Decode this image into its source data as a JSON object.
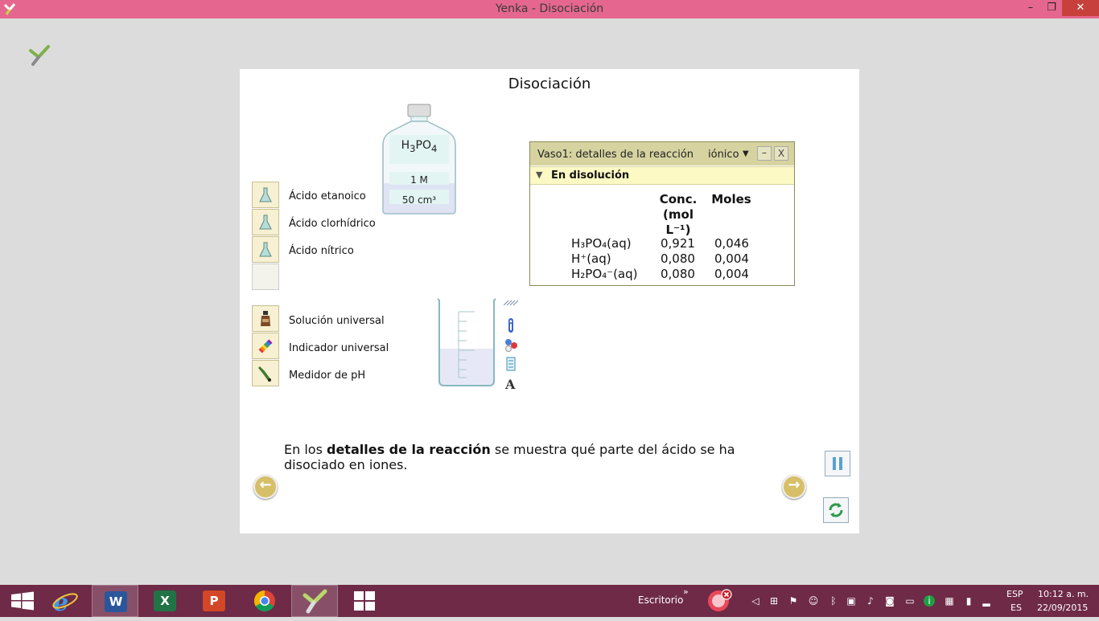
{
  "window": {
    "title": "Yenka - Disociación",
    "min_symbol": "–",
    "max_symbol": "❐",
    "close_symbol": "✕"
  },
  "panel": {
    "title": "Disociación"
  },
  "acids": [
    {
      "label": "Ácido etanoico",
      "icon": "flask-icon"
    },
    {
      "label": "Ácido clorhídrico",
      "icon": "flask-icon"
    },
    {
      "label": "Ácido nítrico",
      "icon": "flask-icon"
    }
  ],
  "tools": [
    {
      "label": "Solución universal",
      "icon": "bottle-icon"
    },
    {
      "label": "Indicador universal",
      "icon": "indicator-strip-icon"
    },
    {
      "label": "Medidor de pH",
      "icon": "ph-meter-icon"
    }
  ],
  "bottle": {
    "formula": "H3PO4",
    "concentration": "1 M",
    "volume": "50 cm³"
  },
  "details": {
    "title": "Vaso1: detalles de la reacción",
    "mode": "iónico",
    "min_symbol": "–",
    "close_symbol": "X",
    "section": "En disolución",
    "col_conc_1": "Conc.",
    "col_conc_2": "(mol",
    "col_conc_3": "L⁻¹)",
    "col_moles": "Moles",
    "rows": [
      {
        "species": "H₃PO₄(aq)",
        "conc": "0,921",
        "moles": "0,046"
      },
      {
        "species": "H⁺(aq)",
        "conc": "0,080",
        "moles": "0,004"
      },
      {
        "species": "H₂PO₄⁻(aq)",
        "conc": "0,080",
        "moles": "0,004"
      }
    ]
  },
  "description": {
    "part1": "En los ",
    "bold": "detalles de la reacción",
    "part2": " se muestra qué parte del ácido se ha disociado en iones."
  },
  "nav": {
    "prev_symbol": "←",
    "next_symbol": "→"
  },
  "taskbar": {
    "desktop_label": "Escritorio",
    "chevron": "»",
    "lang_top": "ESP",
    "lang_bottom": "ES",
    "time": "10:12 a. m.",
    "date": "22/09/2015",
    "apps": [
      "windows-start",
      "internet-explorer",
      "word",
      "excel",
      "powerpoint",
      "chrome",
      "yenka",
      "windows-store"
    ],
    "word_letter": "W",
    "excel_letter": "X",
    "ppt_letter": "P"
  },
  "colors": {
    "titlebar": "#e5678f",
    "taskbar": "#6e2a47",
    "tile": "#f7f0d2",
    "details_header": "#d6d3a0",
    "details_section": "#fdf9c4"
  }
}
